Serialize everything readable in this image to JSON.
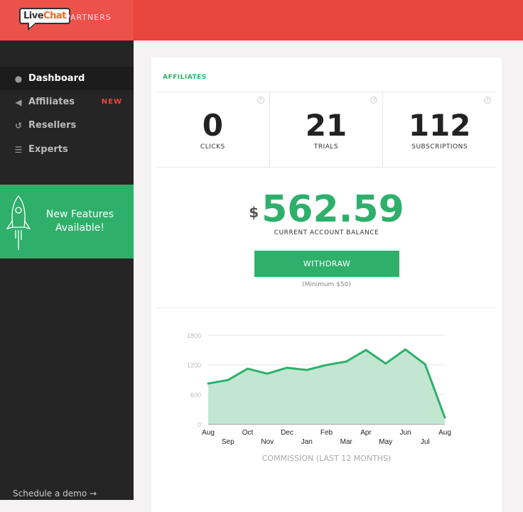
{
  "header": {
    "logo_text": "LiveChat",
    "partners": "PARTNERS"
  },
  "sidebar": {
    "items": [
      {
        "label": "Dashboard",
        "icon": "gauge-icon",
        "active": true
      },
      {
        "label": "Affiliates",
        "icon": "megaphone-icon",
        "badge": "NEW"
      },
      {
        "label": "Resellers",
        "icon": "refresh-icon"
      },
      {
        "label": "Experts",
        "icon": "user-list-icon"
      }
    ],
    "promo": "New Features Available!",
    "demo": "Schedule a demo →"
  },
  "main": {
    "section": "AFFILIATES",
    "stats": [
      {
        "value": "0",
        "label": "CLICKS"
      },
      {
        "value": "21",
        "label": "TRIALS"
      },
      {
        "value": "112",
        "label": "SUBSCRIPTIONS"
      }
    ],
    "currency": "$",
    "balance": "562.59",
    "balance_label": "CURRENT ACCOUNT BALANCE",
    "withdraw": "WITHDRAW",
    "minimum": "(Minimum $50)"
  },
  "colors": {
    "accent": "#2eb06b",
    "brand": "#e8453c"
  },
  "chart_data": {
    "type": "area",
    "categories": [
      "Aug",
      "Sep",
      "Oct",
      "Nov",
      "Dec",
      "Jan",
      "Feb",
      "Mar",
      "Apr",
      "May",
      "Jun",
      "Jul",
      "Aug"
    ],
    "values": [
      820,
      890,
      1120,
      1020,
      1140,
      1095,
      1195,
      1265,
      1500,
      1225,
      1510,
      1210,
      130
    ],
    "ylim": [
      0,
      1800
    ],
    "yticks": [
      0,
      600,
      1200,
      1800
    ],
    "grid": true,
    "xlabel": "COMMISSION (LAST 12 MONTHS)"
  }
}
